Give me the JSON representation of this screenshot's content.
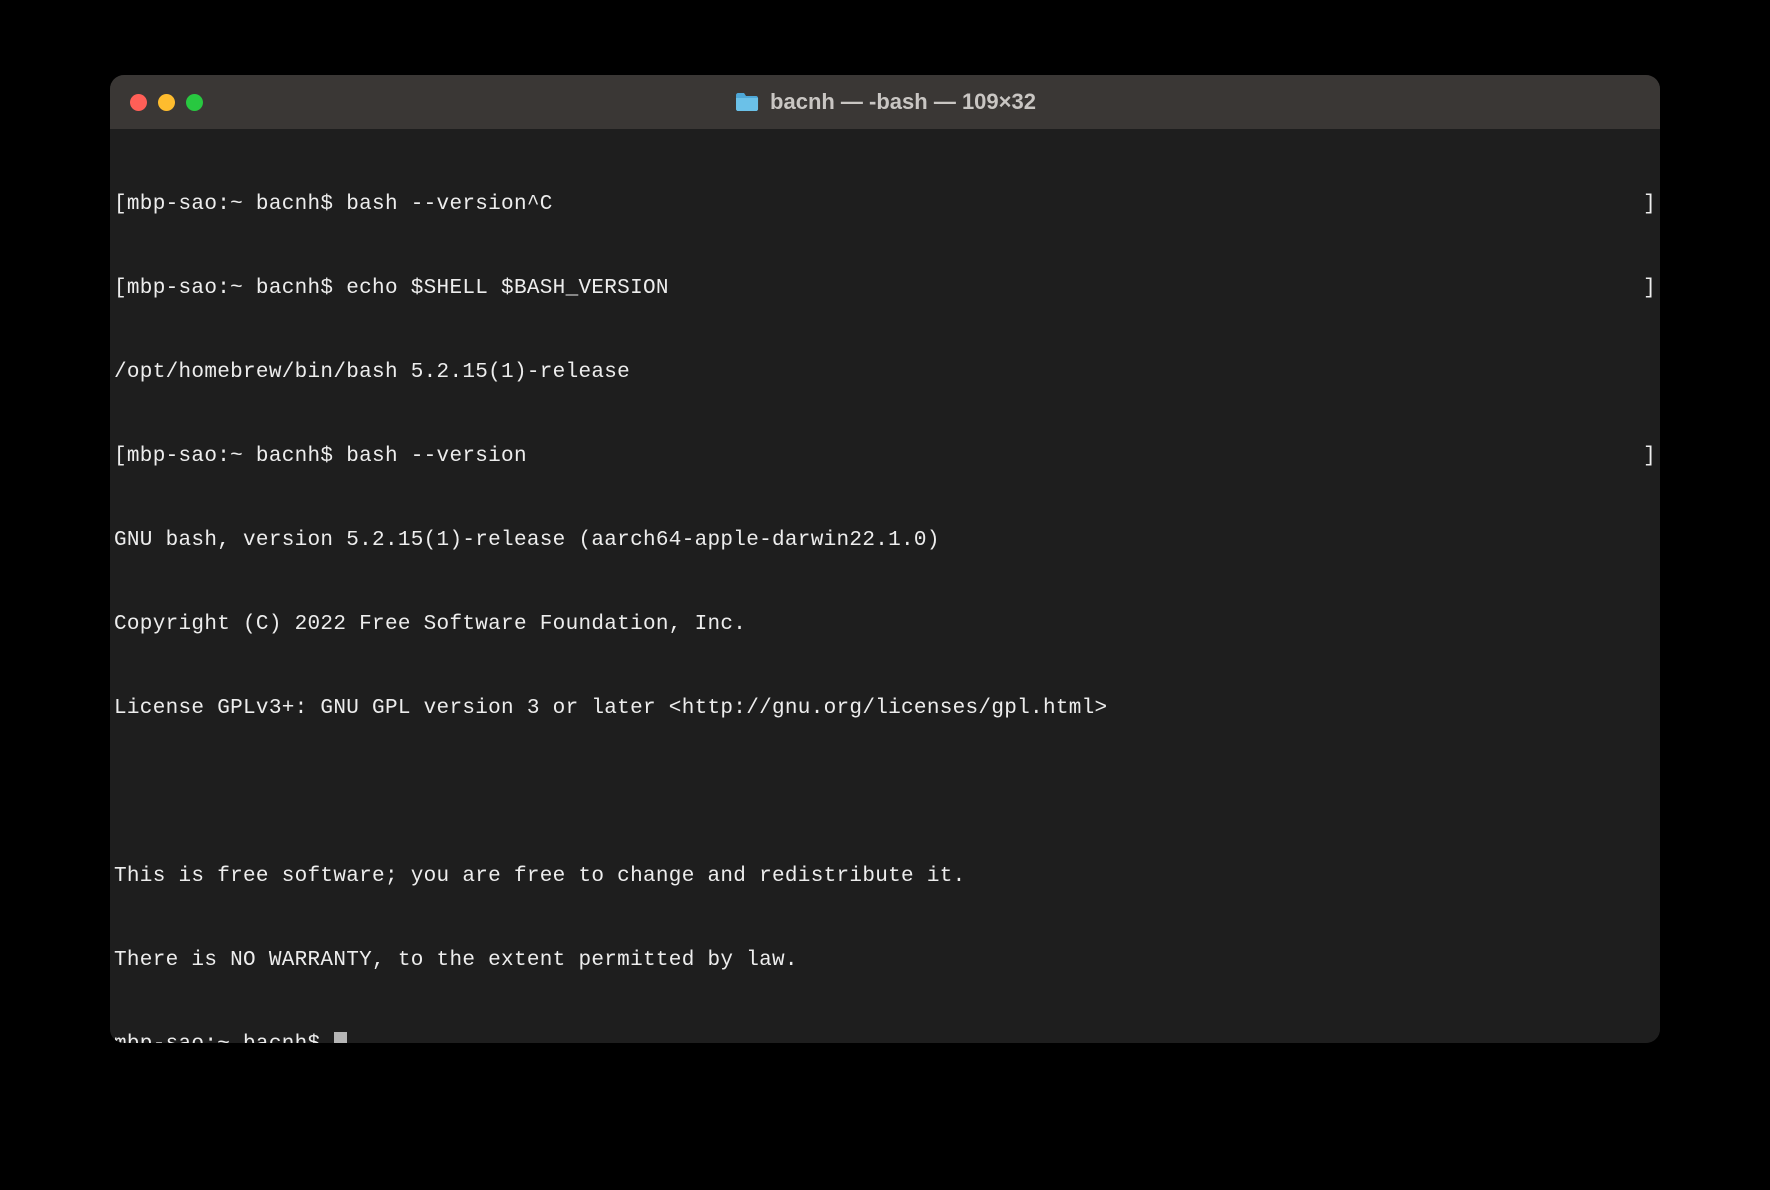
{
  "window": {
    "title": "bacnh — -bash — 109×32",
    "folder_icon": "folder-icon"
  },
  "traffic": {
    "close": "close",
    "minimize": "minimize",
    "maximize": "maximize"
  },
  "terminal": {
    "lines": [
      {
        "left": "[mbp-sao:~ bacnh$ bash --version^C",
        "right": "]"
      },
      {
        "left": "[mbp-sao:~ bacnh$ echo $SHELL $BASH_VERSION",
        "right": "]"
      },
      {
        "left": "/opt/homebrew/bin/bash 5.2.15(1)-release",
        "right": ""
      },
      {
        "left": "[mbp-sao:~ bacnh$ bash --version",
        "right": "]"
      },
      {
        "left": "GNU bash, version 5.2.15(1)-release (aarch64-apple-darwin22.1.0)",
        "right": ""
      },
      {
        "left": "Copyright (C) 2022 Free Software Foundation, Inc.",
        "right": ""
      },
      {
        "left": "License GPLv3+: GNU GPL version 3 or later <http://gnu.org/licenses/gpl.html>",
        "right": ""
      },
      {
        "left": " ",
        "right": ""
      },
      {
        "left": "This is free software; you are free to change and redistribute it.",
        "right": ""
      },
      {
        "left": "There is NO WARRANTY, to the extent permitted by law.",
        "right": ""
      }
    ],
    "prompt": "mbp-sao:~ bacnh$ "
  }
}
